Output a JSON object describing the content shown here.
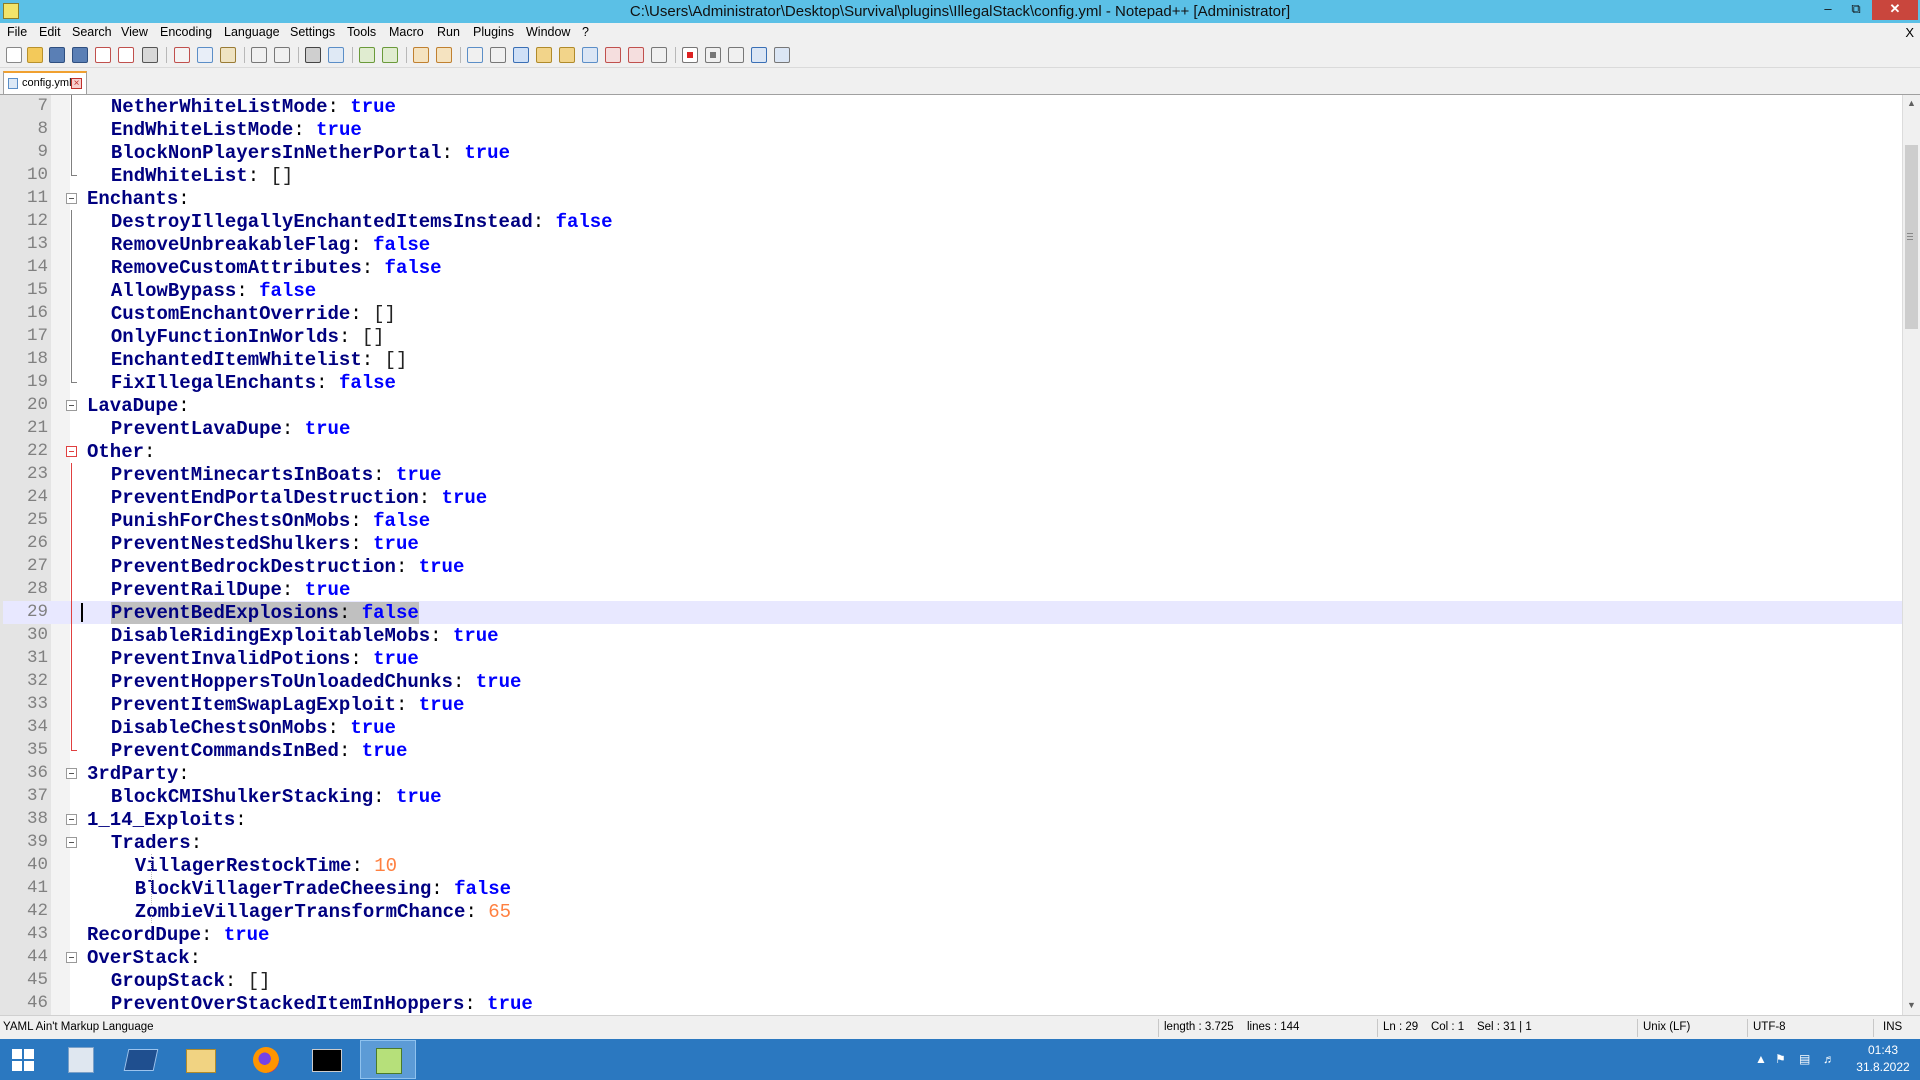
{
  "window": {
    "title": "C:\\Users\\Administrator\\Desktop\\Survival\\plugins\\IllegalStack\\config.yml - Notepad++ [Administrator]",
    "controls": {
      "minimize": "–",
      "restore": "⧉",
      "close": "✕"
    }
  },
  "menu": {
    "items": [
      "File",
      "Edit",
      "Search",
      "View",
      "Encoding",
      "Language",
      "Settings",
      "Tools",
      "Macro",
      "Run",
      "Plugins",
      "Window",
      "?"
    ],
    "close_doc": "X"
  },
  "tab": {
    "label": "config.yml",
    "close": "×"
  },
  "editor": {
    "current_line": 29,
    "lines": [
      {
        "n": "7",
        "key": "NetherWhiteListMode",
        "val": "true",
        "vt": "b",
        "ind": 1
      },
      {
        "n": "8",
        "key": "EndWhiteListMode",
        "val": "true",
        "vt": "b",
        "ind": 1
      },
      {
        "n": "9",
        "key": "BlockNonPlayersInNetherPortal",
        "val": "true",
        "vt": "b",
        "ind": 1
      },
      {
        "n": "10",
        "key": "EndWhiteList",
        "val": "[]",
        "vt": "o",
        "ind": 1
      },
      {
        "n": "11",
        "key": "Enchants",
        "val": "",
        "vt": "",
        "ind": 0
      },
      {
        "n": "12",
        "key": "DestroyIllegallyEnchantedItemsInstead",
        "val": "false",
        "vt": "b",
        "ind": 1
      },
      {
        "n": "13",
        "key": "RemoveUnbreakableFlag",
        "val": "false",
        "vt": "b",
        "ind": 1
      },
      {
        "n": "14",
        "key": "RemoveCustomAttributes",
        "val": "false",
        "vt": "b",
        "ind": 1
      },
      {
        "n": "15",
        "key": "AllowBypass",
        "val": "false",
        "vt": "b",
        "ind": 1
      },
      {
        "n": "16",
        "key": "CustomEnchantOverride",
        "val": "[]",
        "vt": "o",
        "ind": 1
      },
      {
        "n": "17",
        "key": "OnlyFunctionInWorlds",
        "val": "[]",
        "vt": "o",
        "ind": 1
      },
      {
        "n": "18",
        "key": "EnchantedItemWhitelist",
        "val": "[]",
        "vt": "o",
        "ind": 1
      },
      {
        "n": "19",
        "key": "FixIllegalEnchants",
        "val": "false",
        "vt": "b",
        "ind": 1
      },
      {
        "n": "20",
        "key": "LavaDupe",
        "val": "",
        "vt": "",
        "ind": 0
      },
      {
        "n": "21",
        "key": "PreventLavaDupe",
        "val": "true",
        "vt": "b",
        "ind": 1
      },
      {
        "n": "22",
        "key": "Other",
        "val": "",
        "vt": "",
        "ind": 0
      },
      {
        "n": "23",
        "key": "PreventMinecartsInBoats",
        "val": "true",
        "vt": "b",
        "ind": 1
      },
      {
        "n": "24",
        "key": "PreventEndPortalDestruction",
        "val": "true",
        "vt": "b",
        "ind": 1
      },
      {
        "n": "25",
        "key": "PunishForChestsOnMobs",
        "val": "false",
        "vt": "b",
        "ind": 1
      },
      {
        "n": "26",
        "key": "PreventNestedShulkers",
        "val": "true",
        "vt": "b",
        "ind": 1
      },
      {
        "n": "27",
        "key": "PreventBedrockDestruction",
        "val": "true",
        "vt": "b",
        "ind": 1
      },
      {
        "n": "28",
        "key": "PreventRailDupe",
        "val": "true",
        "vt": "b",
        "ind": 1
      },
      {
        "n": "29",
        "key": "PreventBedExplosions",
        "val": "false",
        "vt": "b",
        "ind": 1
      },
      {
        "n": "30",
        "key": "DisableRidingExploitableMobs",
        "val": "true",
        "vt": "b",
        "ind": 1
      },
      {
        "n": "31",
        "key": "PreventInvalidPotions",
        "val": "true",
        "vt": "b",
        "ind": 1
      },
      {
        "n": "32",
        "key": "PreventHoppersToUnloadedChunks",
        "val": "true",
        "vt": "b",
        "ind": 1
      },
      {
        "n": "33",
        "key": "PreventItemSwapLagExploit",
        "val": "true",
        "vt": "b",
        "ind": 1
      },
      {
        "n": "34",
        "key": "DisableChestsOnMobs",
        "val": "true",
        "vt": "b",
        "ind": 1
      },
      {
        "n": "35",
        "key": "PreventCommandsInBed",
        "val": "true",
        "vt": "b",
        "ind": 1
      },
      {
        "n": "36",
        "key": "3rdParty",
        "val": "",
        "vt": "",
        "ind": 0
      },
      {
        "n": "37",
        "key": "BlockCMIShulkerStacking",
        "val": "true",
        "vt": "b",
        "ind": 1
      },
      {
        "n": "38",
        "key": "1_14_Exploits",
        "val": "",
        "vt": "",
        "ind": 0
      },
      {
        "n": "39",
        "key": "Traders",
        "val": "",
        "vt": "",
        "ind": 1
      },
      {
        "n": "40",
        "key": "VillagerRestockTime",
        "val": "10",
        "vt": "n",
        "ind": 2
      },
      {
        "n": "41",
        "key": "BlockVillagerTradeCheesing",
        "val": "false",
        "vt": "b",
        "ind": 2
      },
      {
        "n": "42",
        "key": "ZombieVillagerTransformChance",
        "val": "65",
        "vt": "n",
        "ind": 2
      },
      {
        "n": "43",
        "key": "RecordDupe",
        "val": "true",
        "vt": "b",
        "ind": 0
      },
      {
        "n": "44",
        "key": "OverStack",
        "val": "",
        "vt": "",
        "ind": 0
      },
      {
        "n": "45",
        "key": "GroupStack",
        "val": "[]",
        "vt": "o",
        "ind": 1
      },
      {
        "n": "46",
        "key": "PreventOverStackedItemInHoppers",
        "val": "true",
        "vt": "b",
        "ind": 1
      }
    ]
  },
  "status": {
    "language": "YAML Ain't Markup Language",
    "length": "length : 3.725",
    "lines": "lines : 144",
    "position": "Ln : 29    Col : 1    Sel : 31 | 1",
    "eol": "Unix (LF)",
    "encoding": "UTF-8",
    "mode": "INS"
  },
  "taskbar": {
    "apps": [
      "server-manager-icon",
      "powershell-icon",
      "file-explorer-icon",
      "firefox-icon",
      "command-prompt-icon",
      "notepadpp-icon"
    ],
    "clock_time": "01:43",
    "clock_date": "31.8.2022"
  },
  "colors": {
    "titlebar": "#5bc0e6",
    "key": "#000080",
    "bool": "#0000ff",
    "number": "#ff8040",
    "current_line": "#e8e8ff",
    "taskbar": "#2b78c0"
  }
}
